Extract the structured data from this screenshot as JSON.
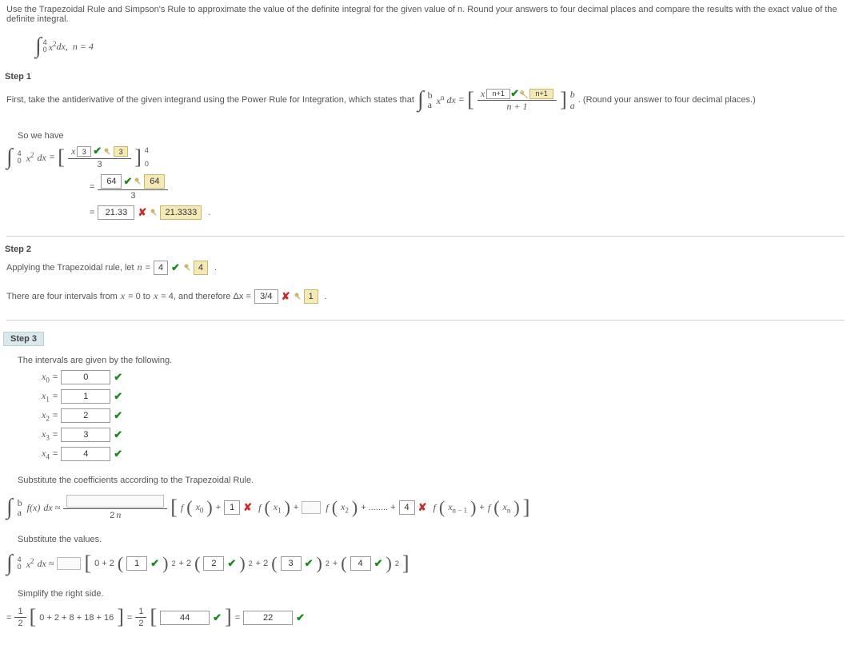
{
  "prompt": "Use the Trapezoidal Rule and Simpson's Rule to approximate the value of the definite integral for the given value of n. Round your answers to four decimal places and compare the results with the exact value of the definite integral.",
  "problem": {
    "int_lower": "0",
    "int_upper": "4",
    "integrand": "x",
    "integrand_sup": "2",
    "dx": " dx,",
    "n_label": "n = 4"
  },
  "step1": {
    "head": "Step 1",
    "text_a": "First, take the antiderivative of the given integrand using the Power Rule for Integration, which states that ",
    "pwr_int_lower": "a",
    "pwr_int_upper": "b",
    "pwr_integrand_base": "x",
    "pwr_integrand_exp": "n",
    "pwr_dx": " dx",
    "eq": " = ",
    "num_base": "x",
    "num_exp_box": "n+1",
    "num_exp_key": "n+1",
    "den_text": "n + 1",
    "limits_upper": "b",
    "limits_lower": "a",
    "round_note": ". (Round your answer to four decimal places.)",
    "so_we_have": "So we have",
    "work_int_lower": "0",
    "work_int_upper": "4",
    "work_integrand_base": "x",
    "work_integrand_exp": "2",
    "work_dx": " dx",
    "frac1_num_x": "x",
    "frac1_num_box": "3",
    "frac1_num_key": "3",
    "frac1_den": "3",
    "frac1_lim_top": "4",
    "frac1_lim_bot": "0",
    "frac2_num_box": "64",
    "frac2_num_key": "64",
    "frac2_den": "3",
    "result_box": "21.33",
    "result_key": "21.3333",
    "period": "."
  },
  "step2": {
    "head": "Step 2",
    "line1_a": "Applying the Trapezoidal rule, let ",
    "line1_n": "n",
    "line1_eq": " = ",
    "n_box": "4",
    "n_key": "4",
    "line2_a": "There are four intervals from ",
    "line2_b": "x",
    "line2_c": " = 0 to ",
    "line2_d": "x",
    "line2_e": " = 4, and therefore Δx = ",
    "dx_box": "3/4",
    "dx_key": "1",
    "period": "."
  },
  "step3": {
    "head": "Step 3",
    "intro": "The intervals are given by the following.",
    "xi": [
      {
        "label_pre": "x",
        "label_sub": "0",
        "val": "0"
      },
      {
        "label_pre": "x",
        "label_sub": "1",
        "val": "1"
      },
      {
        "label_pre": "x",
        "label_sub": "2",
        "val": "2"
      },
      {
        "label_pre": "x",
        "label_sub": "3",
        "val": "3"
      },
      {
        "label_pre": "x",
        "label_sub": "4",
        "val": "4"
      }
    ],
    "sub_title": "Substitute the coefficients according to the Trapezoidal Rule.",
    "int_lower": "a",
    "int_upper": "b",
    "fx": "f(x)",
    "dx": " dx ≈ ",
    "frac_den_a": "2",
    "frac_den_b": "n",
    "fx0_f": "f",
    "fx0_x": "x",
    "fx0_sub": "0",
    "plus": " + ",
    "c1_box": "1",
    "fx1_f": "f",
    "fx1_x": "x",
    "fx1_sub": "1",
    "fx2_f": "f",
    "fx2_x": "x",
    "fx2_sub": "2",
    "dots": " + ........ + ",
    "cn1_box": "4",
    "fxn1_f": "f",
    "fxn1_x": "x",
    "fxn1_sub": "n − 1",
    "fxn_f": "f",
    "fxn_x": "x",
    "fxn_sub": "n",
    "sub_values_title": "Substitute the values.",
    "v_int_lower": "0",
    "v_int_upper": "4",
    "v_integrand_base": "x",
    "v_integrand_exp": "2",
    "v_dx": " dx ≈ ",
    "v_zero": "0 + 2",
    "v_b1": "1",
    "v_b2": "2",
    "v_b3": "3",
    "v_b4": "4",
    "plus2": " + 2",
    "plus1": " + ",
    "sq_sup": "2",
    "simplify": "Simplify the right side.",
    "sum_text": "0 + 2 + 8 + 18 + 16",
    "half_num": "1",
    "half_den": "2",
    "sum_box": "44",
    "result_box": "22"
  }
}
